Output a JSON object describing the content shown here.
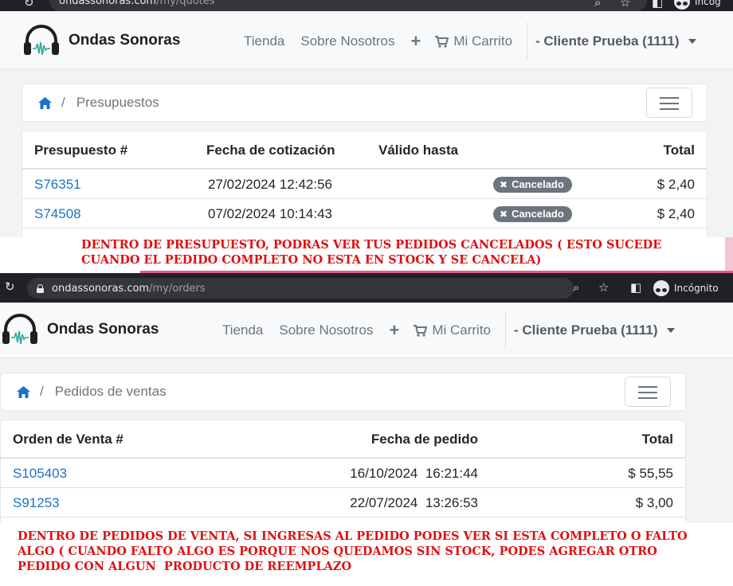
{
  "colors": {
    "link": "#1a73c8",
    "note": "#e01010",
    "badge": "#6c757d",
    "navbar_bg": "#f8f9fa"
  },
  "top": {
    "browser": {
      "url_host": "ondassonoras.com",
      "url_path": "/my/quotes",
      "incognito_label": "Incóg"
    },
    "navbar": {
      "brand": "Ondas Sonoras",
      "links": [
        "Tienda",
        "Sobre Nosotros"
      ],
      "plus": "+",
      "cart": "Mi Carrito",
      "user": "- Cliente Prueba (1111)"
    },
    "breadcrumb": {
      "current": "Presupuestos",
      "separator": "/"
    },
    "table": {
      "headers": {
        "number": "Presupuesto #",
        "date": "Fecha de cotización",
        "valid": "Válido hasta",
        "total": "Total"
      },
      "rows": [
        {
          "number": "S76351",
          "date": "27/02/2024 12:42:56",
          "status": "Cancelado",
          "total": "$ 2,40"
        },
        {
          "number": "S74508",
          "date": "07/02/2024 10:14:43",
          "status": "Cancelado",
          "total": "$ 2,40"
        }
      ]
    },
    "note": "DENTRO DE PRESUPUESTO, PODRAS VER TUS PEDIDOS CANCELADOS ( ESTO SUCEDE\nCUANDO EL PEDIDO COMPLETO NO ESTA EN STOCK Y SE CANCELA)"
  },
  "bottom": {
    "browser": {
      "url_host": "ondassonoras.com",
      "url_path": "/my/orders",
      "incognito_label": "Incógnito"
    },
    "navbar": {
      "brand": "Ondas Sonoras",
      "links": [
        "Tienda",
        "Sobre Nosotros"
      ],
      "plus": "+",
      "cart": "Mi Carrito",
      "user": "- Cliente Prueba (1111)"
    },
    "breadcrumb": {
      "current": "Pedidos de ventas",
      "separator": "/"
    },
    "table": {
      "headers": {
        "number": "Orden de Venta #",
        "date": "Fecha de pedido",
        "total": "Total"
      },
      "rows": [
        {
          "number": "S105403",
          "date": "16/10/2024  16:21:44",
          "total": "$ 55,55"
        },
        {
          "number": "S91253",
          "date": "22/07/2024  13:26:53",
          "total": "$ 3,00"
        }
      ]
    },
    "note": "DENTRO DE PEDIDOS DE VENTA, SI INGRESAS AL PEDIDO PODES VER SI ESTA COMPLETO O FALTO\nALGO ( CUANDO FALTO ALGO ES PORQUE NOS QUEDAMOS SIN STOCK, PODES AGREGAR OTRO\nPEDIDO CON ALGUN  PRODUCTO DE REEMPLAZO"
  }
}
